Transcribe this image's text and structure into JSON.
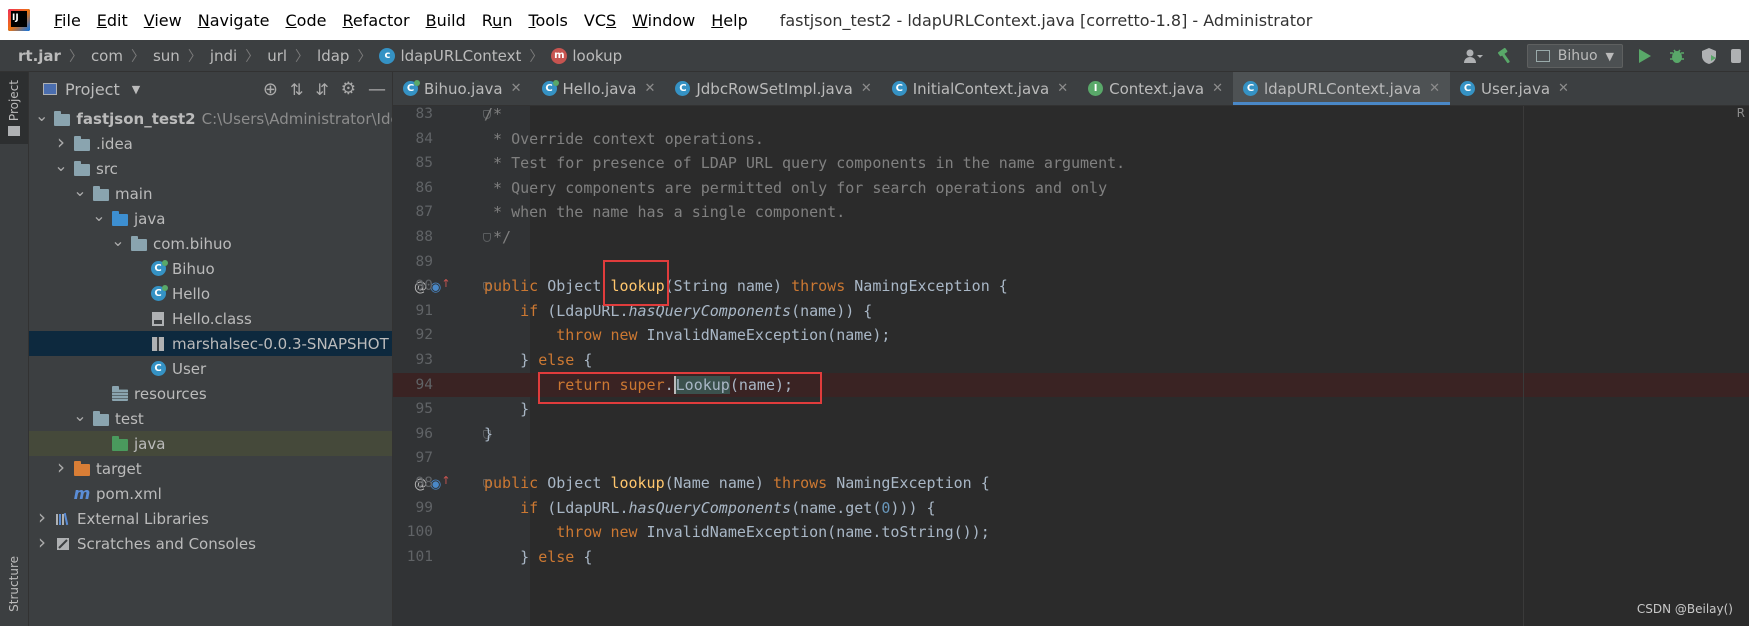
{
  "menubar": {
    "items": [
      {
        "pre": "",
        "mn": "F",
        "post": "ile"
      },
      {
        "pre": "",
        "mn": "E",
        "post": "dit"
      },
      {
        "pre": "",
        "mn": "V",
        "post": "iew"
      },
      {
        "pre": "",
        "mn": "N",
        "post": "avigate"
      },
      {
        "pre": "",
        "mn": "C",
        "post": "ode"
      },
      {
        "pre": "",
        "mn": "R",
        "post": "efactor"
      },
      {
        "pre": "",
        "mn": "B",
        "post": "uild"
      },
      {
        "pre": "R",
        "mn": "u",
        "post": "n"
      },
      {
        "pre": "",
        "mn": "T",
        "post": "ools"
      },
      {
        "pre": "VC",
        "mn": "S",
        "post": ""
      },
      {
        "pre": "",
        "mn": "W",
        "post": "indow"
      },
      {
        "pre": "",
        "mn": "H",
        "post": "elp"
      }
    ],
    "title": "fastjson_test2 - ldapURLContext.java [corretto-1.8] - Administrator"
  },
  "breadcrumb": {
    "items": [
      "rt.jar",
      "com",
      "sun",
      "jndi",
      "url",
      "ldap",
      "ldapURLContext",
      "lookup"
    ]
  },
  "toolbar": {
    "run_config": "Bihuo"
  },
  "left_stripe": {
    "project_label": "Project",
    "structure_label": "Structure"
  },
  "project_panel": {
    "title": "Project",
    "tree": [
      {
        "label": "fastjson_test2",
        "hint": "C:\\Users\\Administrator\\Ide"
      },
      {
        "label": ".idea"
      },
      {
        "label": "src"
      },
      {
        "label": "main"
      },
      {
        "label": "java"
      },
      {
        "label": "com.bihuo"
      },
      {
        "label": "Bihuo"
      },
      {
        "label": "Hello"
      },
      {
        "label": "Hello.class"
      },
      {
        "label": "marshalsec-0.0.3-SNAPSHOT"
      },
      {
        "label": "User"
      },
      {
        "label": "resources"
      },
      {
        "label": "test"
      },
      {
        "label": "java"
      },
      {
        "label": "target"
      },
      {
        "label": "pom.xml"
      },
      {
        "label": "External Libraries"
      },
      {
        "label": "Scratches and Consoles"
      }
    ]
  },
  "tabs": [
    {
      "label": "Bihuo.java"
    },
    {
      "label": "Hello.java"
    },
    {
      "label": "JdbcRowSetImpl.java"
    },
    {
      "label": "InitialContext.java"
    },
    {
      "label": "Context.java"
    },
    {
      "label": "ldapURLContext.java"
    },
    {
      "label": "User.java"
    }
  ],
  "editor": {
    "line_numbers": [
      "83",
      "84",
      "85",
      "86",
      "87",
      "88",
      "89",
      "90",
      "91",
      "92",
      "93",
      "94",
      "95",
      "96",
      "97",
      "98",
      "99",
      "100",
      "101"
    ],
    "comment_lines": [
      "/*",
      " * Override context operations.",
      " * Test for presence of LDAP URL query components in the name argument.",
      " * Query components are permitted only for search operations and only",
      " * when the name has a single component.",
      " */"
    ],
    "tokens": {
      "public": "public",
      "object": " Object ",
      "lookup": "lookup",
      "sig1": "(String name) ",
      "throws": "throws",
      "naming_exc": " NamingException {",
      "if": "if",
      "ldapurl": " (LdapURL.",
      "hasqc": "hasQueryComponents",
      "name_arg": "(name)) {",
      "throw": "throw",
      "new": "new",
      "invalid1": " InvalidNameException(name);",
      "close_else": "} ",
      "else": "else",
      "brace_open": " {",
      "return": "return",
      "super": "super",
      "dot": ".",
      "lookup_cap": "Lookup",
      "name_semi": "(name);",
      "brace_close": "}",
      "sig2": "(Name name) ",
      "get_pre": "(name.get(",
      "zero": "0",
      "get_post": "))) {",
      "invalid2": " InvalidNameException(name.toString());"
    },
    "right_marker": "R"
  },
  "watermark": "CSDN @Beilay()"
}
